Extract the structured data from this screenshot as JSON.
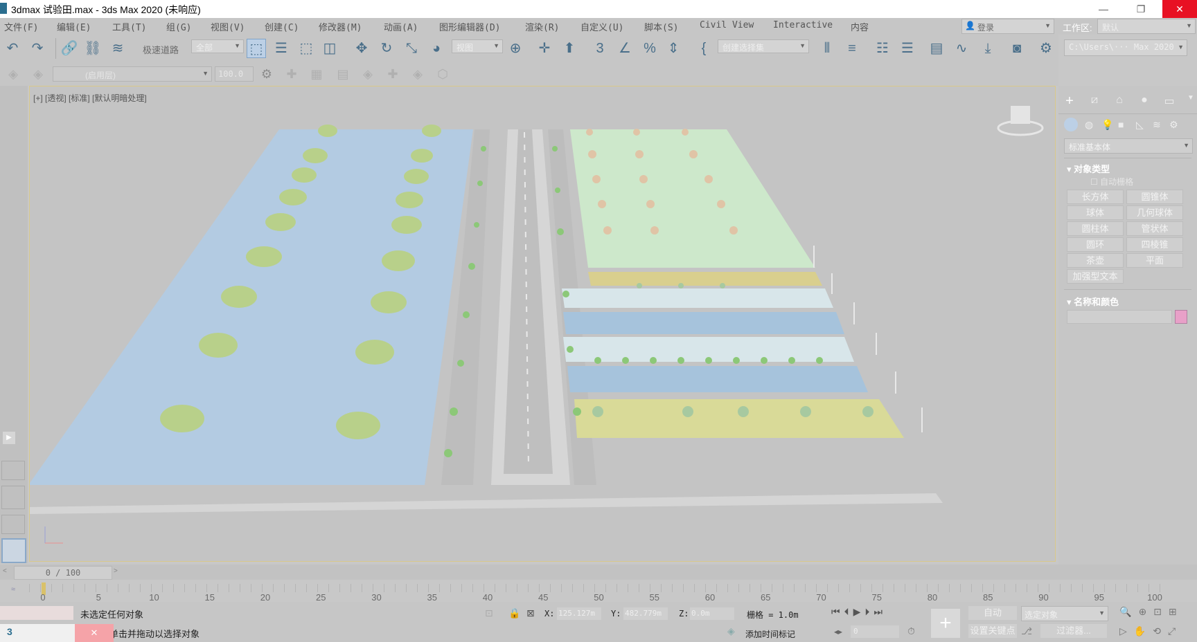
{
  "window": {
    "title": "3dmax 试验田.max - 3ds Max 2020  (未响应)",
    "minimize": "—",
    "maximize": "❐",
    "close": "✕"
  },
  "menu": [
    "文件(F)",
    "编辑(E)",
    "工具(T)",
    "组(G)",
    "视图(V)",
    "创建(C)",
    "修改器(M)",
    "动画(A)",
    "图形编辑器(D)",
    "渲染(R)",
    "自定义(U)",
    "脚本(S)",
    "Civil View",
    "Interactive",
    "内容"
  ],
  "account": {
    "label": "登录"
  },
  "workspace": {
    "label": "工作区:",
    "value": "默认"
  },
  "toolbar": {
    "tool_label": "极速道路",
    "selection_filter": "全部",
    "ref_coord": "视图",
    "named_selection": "创建选择集",
    "project_path": "C:\\Users\\··· Max 2020"
  },
  "toolbar2": {
    "layer_field": "(启用层)",
    "spin_value": "100.0"
  },
  "viewport": {
    "label": "[+] [透视] [标准] [默认明暗处理]"
  },
  "command_panel": {
    "category": "标准基本体",
    "rollout_object_type": "对象类型",
    "autogrid": "自动栅格",
    "buttons": [
      "长方体",
      "圆锥体",
      "球体",
      "几何球体",
      "圆柱体",
      "管状体",
      "圆环",
      "四棱锥",
      "茶壶",
      "平面",
      "加强型文本"
    ],
    "rollout_name_color": "名称和颜色",
    "color_swatch": "#e8a0c8"
  },
  "time_slider": {
    "value": "0 / 100"
  },
  "track": {
    "ticks": [
      "0",
      "5",
      "10",
      "15",
      "20",
      "25",
      "30",
      "35",
      "40",
      "45",
      "50",
      "55",
      "60",
      "65",
      "70",
      "75",
      "80",
      "85",
      "90",
      "95",
      "100"
    ]
  },
  "status": {
    "selection": "未选定任何对象",
    "prompt": "单击并拖动以选择对象",
    "x_label": "X:",
    "x_value": "125.127m",
    "y_label": "Y:",
    "y_value": "482.779m",
    "z_label": "Z:",
    "z_value": "0.0m",
    "grid": "栅格 = 1.0m",
    "add_time_tag": "添加时间标记",
    "auto_key": "自动",
    "selected_mode": "选定对象",
    "set_key": "设置关键点",
    "filters": "过滤器...",
    "frame": "0"
  },
  "colors": {
    "water": "#b3cbe2",
    "lawn": "#cde8cb",
    "sand": "#d9cf8e",
    "road": "#d6d6d6",
    "tree": "#8cc878"
  }
}
